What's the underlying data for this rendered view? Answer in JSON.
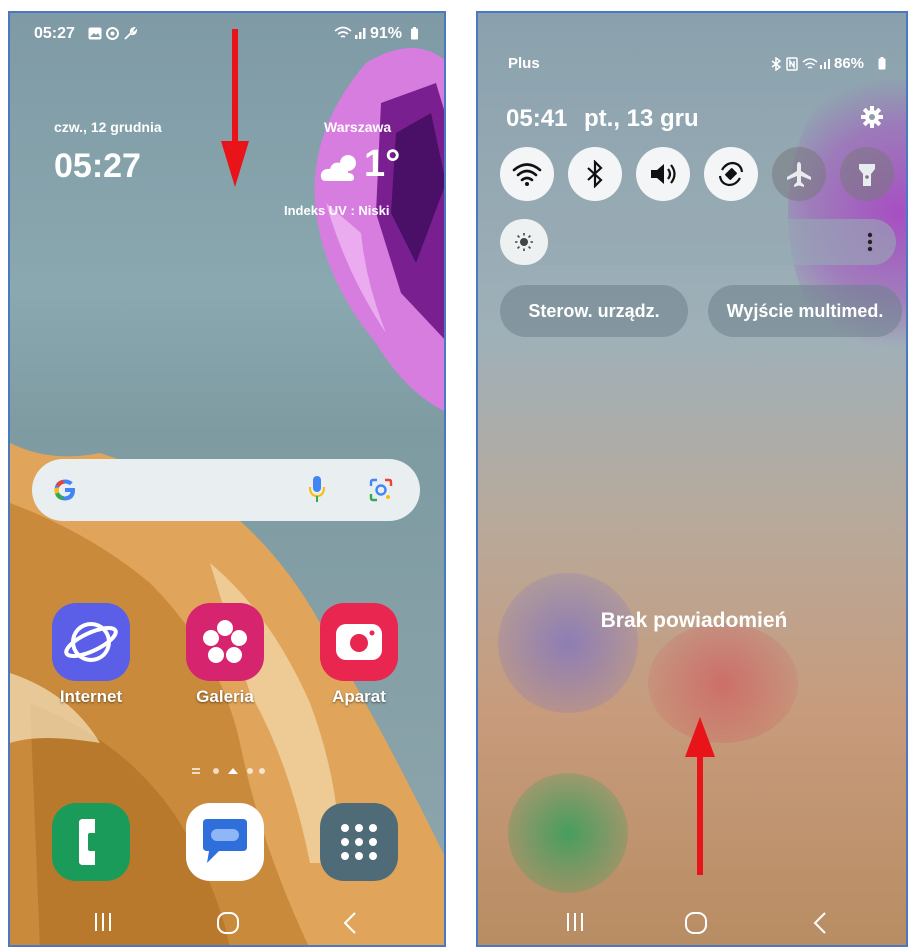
{
  "left": {
    "status_bar": {
      "time": "05:27",
      "battery": "91%",
      "icons": [
        "gallery-icon",
        "target-icon",
        "wrench-icon",
        "wifi-icon",
        "signal-icon",
        "battery-icon"
      ]
    },
    "clock_widget": {
      "date": "czw., 12 grudnia",
      "time": "05:27"
    },
    "weather_widget": {
      "city": "Warszawa",
      "temperature": "1°",
      "uv": "Indeks UV : Niski",
      "icon": "cloud-icon"
    },
    "search_bar": {
      "icons": [
        "google-logo",
        "mic-icon",
        "lens-icon"
      ]
    },
    "apps": [
      {
        "label": "Internet",
        "icon": "internet-icon",
        "color": "#5b5ee6"
      },
      {
        "label": "Galeria",
        "icon": "gallery-flower-icon",
        "color": "#d7246f"
      },
      {
        "label": "Aparat",
        "icon": "camera-icon",
        "color": "#e8264f"
      }
    ],
    "dock": [
      {
        "icon": "phone-icon",
        "color": "#1a9b5a"
      },
      {
        "icon": "messages-icon",
        "color": "#ffffff"
      },
      {
        "icon": "app-drawer-icon",
        "color": "#4f6b78"
      }
    ],
    "nav": [
      "recents-icon",
      "home-icon",
      "back-icon"
    ],
    "arrow": "swipe-down-arrow"
  },
  "right": {
    "status_bar": {
      "carrier": "Plus",
      "battery": "86%",
      "icons": [
        "bluetooth-icon",
        "nfc-icon",
        "wifi-icon",
        "signal-icon",
        "battery-icon"
      ]
    },
    "header": {
      "time": "05:41",
      "date": "pt., 13 gru"
    },
    "quick_settings": [
      "wifi-icon",
      "bluetooth-icon",
      "sound-icon",
      "autorotate-icon",
      "airplane-icon",
      "flashlight-icon"
    ],
    "brightness_level": 0.12,
    "buttons": {
      "device_control": "Sterow. urządz.",
      "media_output": "Wyjście multimed."
    },
    "empty_text": "Brak powiadomień",
    "nav": [
      "recents-icon",
      "home-icon",
      "back-icon"
    ],
    "arrow": "swipe-up-arrow"
  },
  "colors": {
    "arrow": "#e8141a",
    "frame": "#4a78c2"
  }
}
